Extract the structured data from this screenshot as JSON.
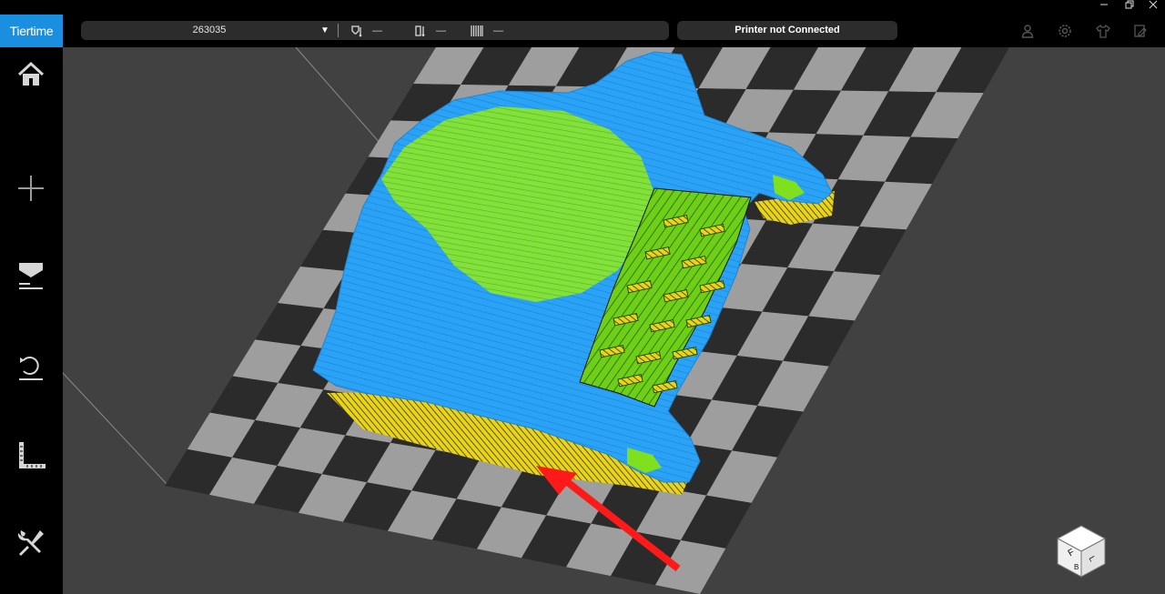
{
  "app": {
    "logo_text": "Tiertime",
    "brand_color": "#1a8fe0"
  },
  "window_controls": {
    "minimize_icon": "minimize-icon",
    "restore_icon": "restore-icon",
    "close_icon": "close-icon"
  },
  "toolbar": {
    "printer_name": "263035",
    "nozzle_temp": "—",
    "bed_temp": "—",
    "material_status": "—",
    "connection_status": "Printer not Connected",
    "icons": [
      "user-icon",
      "settings-icon",
      "material-icon",
      "print-queue-icon"
    ]
  },
  "sidebar": {
    "items": [
      {
        "name": "home",
        "icon": "home-icon"
      },
      {
        "name": "add",
        "icon": "plus-icon"
      },
      {
        "name": "print",
        "icon": "print-icon"
      },
      {
        "name": "calibrate",
        "icon": "calibrate-icon"
      },
      {
        "name": "measure",
        "icon": "ruler-icon"
      },
      {
        "name": "tools",
        "icon": "wrench-icon"
      }
    ]
  },
  "viewport": {
    "bed_colors": {
      "light": "#9e9e9e",
      "dark": "#2b2b2b"
    },
    "model_colors": {
      "shell": "#2aa3f7",
      "infill": "#7fe01e",
      "raft": "#e8d41a"
    },
    "arrow_color": "#ff1a1a",
    "view_cube_faces": [
      "F",
      "L",
      "B"
    ]
  }
}
